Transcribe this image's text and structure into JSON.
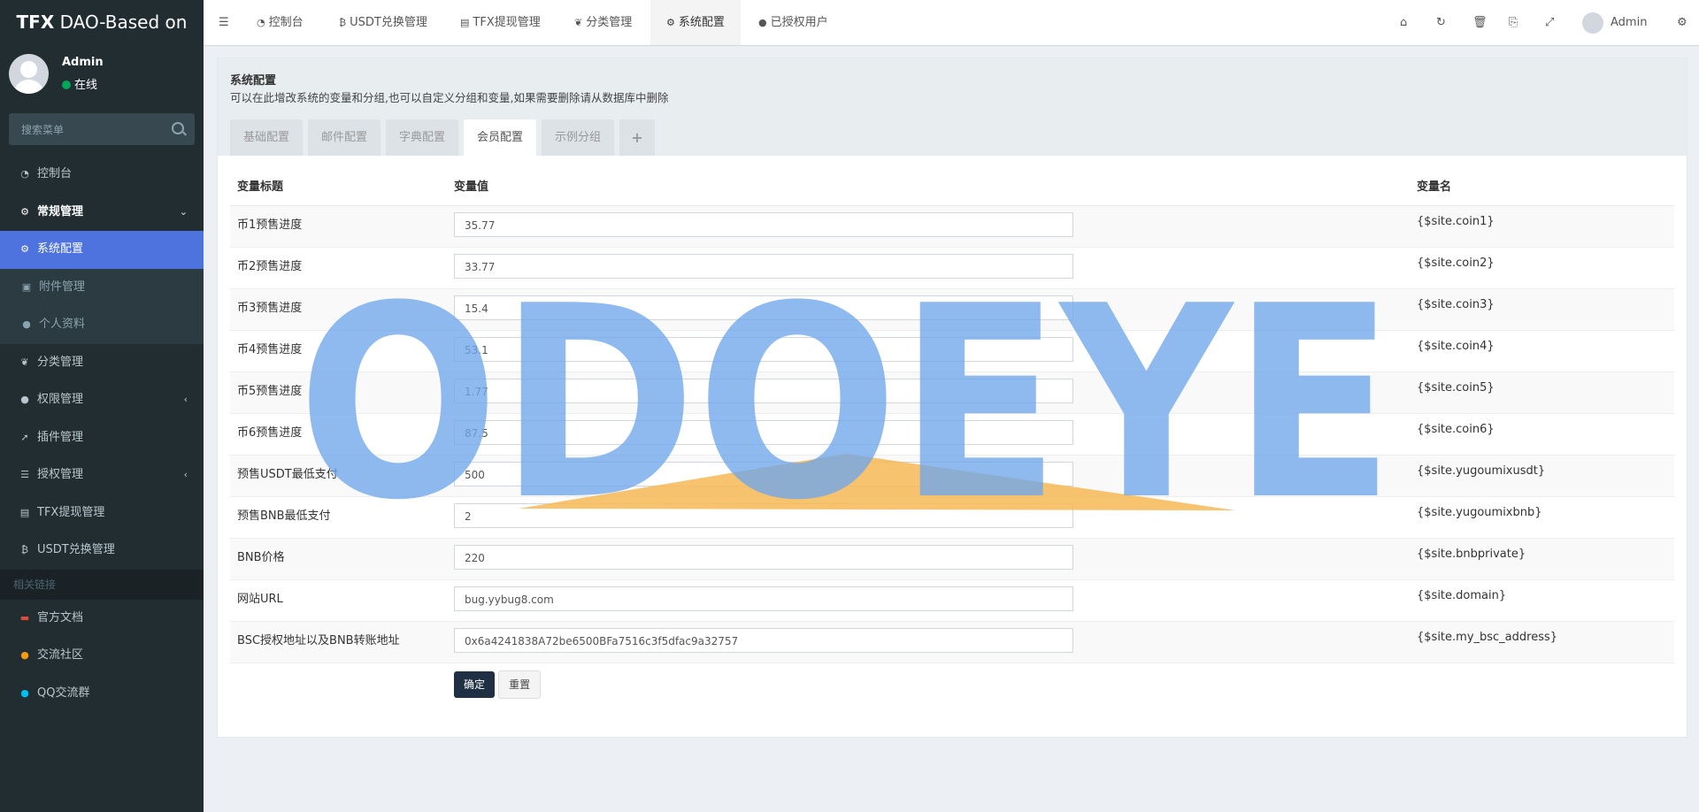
{
  "app": {
    "brand_bold": "TFX",
    "brand_rest": " DAO-Based on"
  },
  "user": {
    "name": "Admin",
    "status": "在线"
  },
  "sidebar": {
    "search_placeholder": "搜索菜单",
    "items": [
      {
        "label": "控制台",
        "icon": "dashboard-icon"
      },
      {
        "label": "常规管理",
        "icon": "cogs-icon"
      },
      {
        "label": "系统配置",
        "icon": "gear-icon"
      },
      {
        "label": "附件管理",
        "icon": "image-icon"
      },
      {
        "label": "个人资料",
        "icon": "user-icon"
      },
      {
        "label": "分类管理",
        "icon": "leaf-icon"
      },
      {
        "label": "权限管理",
        "icon": "group-icon"
      },
      {
        "label": "插件管理",
        "icon": "rocket-icon"
      },
      {
        "label": "授权管理",
        "icon": "list-icon"
      },
      {
        "label": "TFX提现管理",
        "icon": "id-card-icon"
      },
      {
        "label": "USDT兑换管理",
        "icon": "bitcoin-icon"
      }
    ],
    "links_header": "相关链接",
    "links": [
      {
        "label": "官方文档",
        "icon": "book-icon",
        "color": "#dd4b39"
      },
      {
        "label": "交流社区",
        "icon": "comment-icon",
        "color": "#f39c12"
      },
      {
        "label": "QQ交流群",
        "icon": "qq-icon",
        "color": "#00c0ef"
      }
    ]
  },
  "topnav": {
    "tabs": [
      {
        "label": "控制台",
        "icon": "dashboard-icon"
      },
      {
        "label": "USDT兑换管理",
        "icon": "bitcoin-icon"
      },
      {
        "label": "TFX提现管理",
        "icon": "id-card-icon"
      },
      {
        "label": "分类管理",
        "icon": "leaf-icon"
      },
      {
        "label": "系统配置",
        "icon": "gear-icon"
      },
      {
        "label": "已授权用户",
        "icon": "user-icon"
      }
    ],
    "user_label": "Admin"
  },
  "panel": {
    "title": "系统配置",
    "description": "可以在此增改系统的变量和分组,也可以自定义分组和变量,如果需要删除请从数据库中删除",
    "tabs": [
      "基础配置",
      "邮件配置",
      "字典配置",
      "会员配置",
      "示例分组",
      "+"
    ],
    "active_tab": "会员配置"
  },
  "table": {
    "headers": [
      "变量标题",
      "变量值",
      "变量名"
    ],
    "rows": [
      {
        "title": "币1预售进度",
        "value": "35.77",
        "name": "{$site.coin1}"
      },
      {
        "title": "币2预售进度",
        "value": "33.77",
        "name": "{$site.coin2}"
      },
      {
        "title": "币3预售进度",
        "value": "15.4",
        "name": "{$site.coin3}"
      },
      {
        "title": "币4预售进度",
        "value": "53.1",
        "name": "{$site.coin4}"
      },
      {
        "title": "币5预售进度",
        "value": "1.77",
        "name": "{$site.coin5}"
      },
      {
        "title": "币6预售进度",
        "value": "87.5",
        "name": "{$site.coin6}"
      },
      {
        "title": "预售USDT最低支付",
        "value": "500",
        "name": "{$site.yugoumixusdt}"
      },
      {
        "title": "预售BNB最低支付",
        "value": "2",
        "name": "{$site.yugoumixbnb}"
      },
      {
        "title": "BNB价格",
        "value": "220",
        "name": "{$site.bnbprivate}"
      },
      {
        "title": "网站URL",
        "value": "bug.yybug8.com",
        "name": "{$site.domain}"
      },
      {
        "title": "BSC授权地址以及BNB转账地址",
        "value": "0x6a4241838A72be6500BFa7516c3f5dfac9a32757",
        "name": "{$site.my_bsc_address}"
      }
    ]
  },
  "buttons": {
    "submit": "确定",
    "reset": "重置"
  },
  "watermark": {
    "text": "ODOEYE"
  },
  "colors": {
    "sidebar_bg": "#222d32",
    "active_menu": "#4e73df",
    "primary_button": "#1f3045",
    "watermark_blue": "#6ea6ec",
    "watermark_orange": "#f7b955"
  }
}
